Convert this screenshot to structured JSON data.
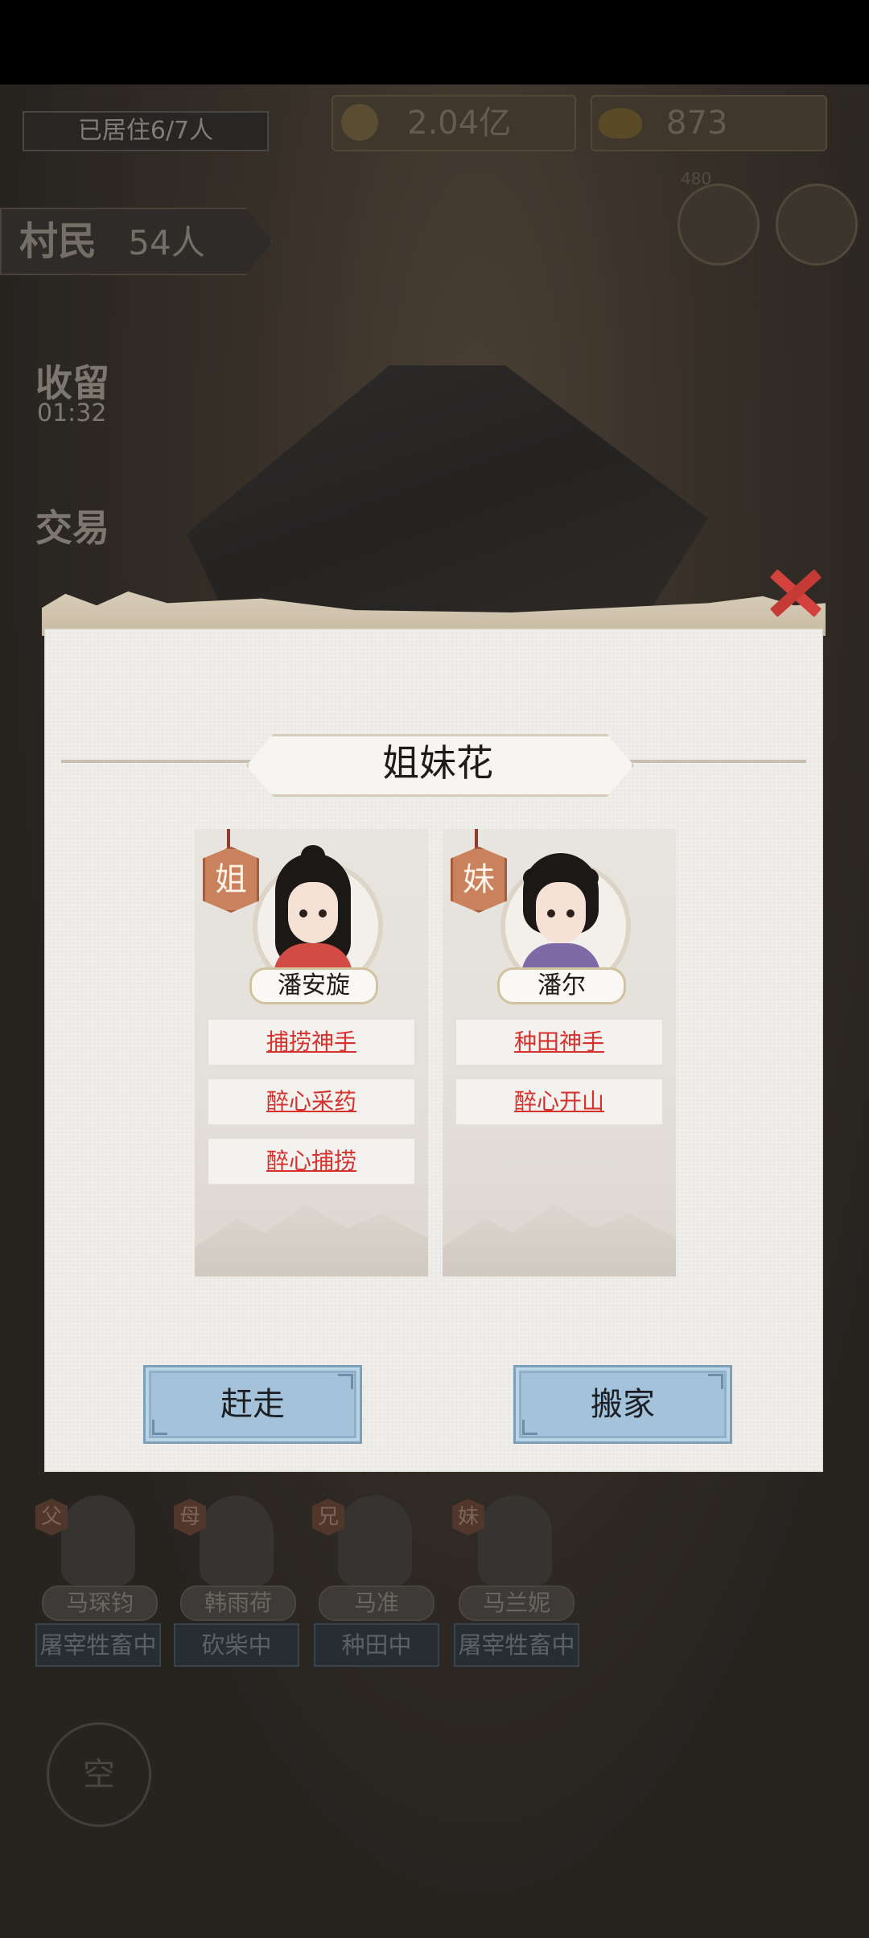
{
  "hud": {
    "residents_label": "已居住6/7人",
    "coins": "2.04亿",
    "ingots": "873",
    "side_badge_title": "村民",
    "side_badge_count": "54人",
    "side_buttons": [
      "收留",
      "交易"
    ],
    "side_timer": "01:32",
    "badge_number": "480"
  },
  "modal": {
    "title": "姐妹花",
    "cards": [
      {
        "tag": "姐",
        "name": "潘安旋",
        "robe_color": "#d24b45",
        "traits": [
          "捕捞神手",
          "醉心采药",
          "醉心捕捞"
        ]
      },
      {
        "tag": "妹",
        "name": "潘尔",
        "robe_color": "#7d6aa6",
        "traits": [
          "种田神手",
          "醉心开山"
        ]
      }
    ],
    "buttons": {
      "evict": "赶走",
      "move": "搬家"
    }
  },
  "family": {
    "members": [
      {
        "tag": "父",
        "name": "马琛钧",
        "status": "屠宰牲畜中"
      },
      {
        "tag": "母",
        "name": "韩雨荷",
        "status": "砍柴中"
      },
      {
        "tag": "兄",
        "name": "马准",
        "status": "种田中"
      },
      {
        "tag": "妹",
        "name": "马兰妮",
        "status": "屠宰牲畜中"
      }
    ],
    "empty_slot": "空"
  }
}
